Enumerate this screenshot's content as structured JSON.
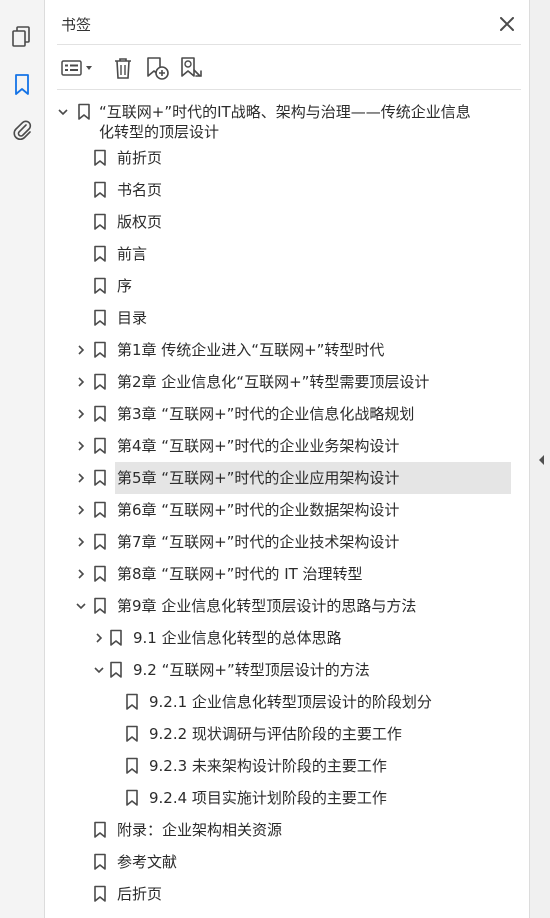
{
  "panel": {
    "title": "书签"
  },
  "bookmarks": [
    {
      "label": "“互联网+”时代的IT战略、架构与治理——传统企业信息化转型的顶层设计",
      "expand": "open"
    },
    {
      "label": "前折页"
    },
    {
      "label": "书名页"
    },
    {
      "label": "版权页"
    },
    {
      "label": "前言"
    },
    {
      "label": "序"
    },
    {
      "label": "目录"
    },
    {
      "label": "第1章 传统企业进入“互联网+”转型时代",
      "expand": "closed"
    },
    {
      "label": "第2章 企业信息化“互联网+”转型需要顶层设计",
      "expand": "closed"
    },
    {
      "label": "第3章 “互联网+”时代的企业信息化战略规划",
      "expand": "closed"
    },
    {
      "label": "第4章 “互联网+”时代的企业业务架构设计",
      "expand": "closed"
    },
    {
      "label": "第5章 “互联网+”时代的企业应用架构设计",
      "expand": "closed",
      "selected": true
    },
    {
      "label": "第6章 “互联网+”时代的企业数据架构设计",
      "expand": "closed"
    },
    {
      "label": "第7章 “互联网+”时代的企业技术架构设计",
      "expand": "closed"
    },
    {
      "label": "第8章 “互联网+”时代的 IT 治理转型",
      "expand": "closed"
    },
    {
      "label": "第9章 企业信息化转型顶层设计的思路与方法",
      "expand": "open"
    },
    {
      "label": "9.1 企业信息化转型的总体思路",
      "expand": "closed"
    },
    {
      "label": "9.2 “互联网+”转型顶层设计的方法",
      "expand": "open"
    },
    {
      "label": "9.2.1 企业信息化转型顶层设计的阶段划分"
    },
    {
      "label": "9.2.2 现状调研与评估阶段的主要工作"
    },
    {
      "label": "9.2.3 未来架构设计阶段的主要工作"
    },
    {
      "label": "9.2.4 项目实施计划阶段的主要工作"
    },
    {
      "label": "附录：企业架构相关资源"
    },
    {
      "label": "参考文献"
    },
    {
      "label": "后折页"
    }
  ],
  "icons": {
    "strip": [
      "pages-icon",
      "bookmark-icon",
      "attachment-icon"
    ],
    "toolbar": [
      "options-menu-icon",
      "delete-icon",
      "add-bookmark-icon",
      "find-bookmark-icon"
    ],
    "close": "close-icon"
  },
  "colors": {
    "accent": "#1473e6",
    "icon": "#4b4b4b",
    "selected_bg": "#e5e5e5"
  }
}
